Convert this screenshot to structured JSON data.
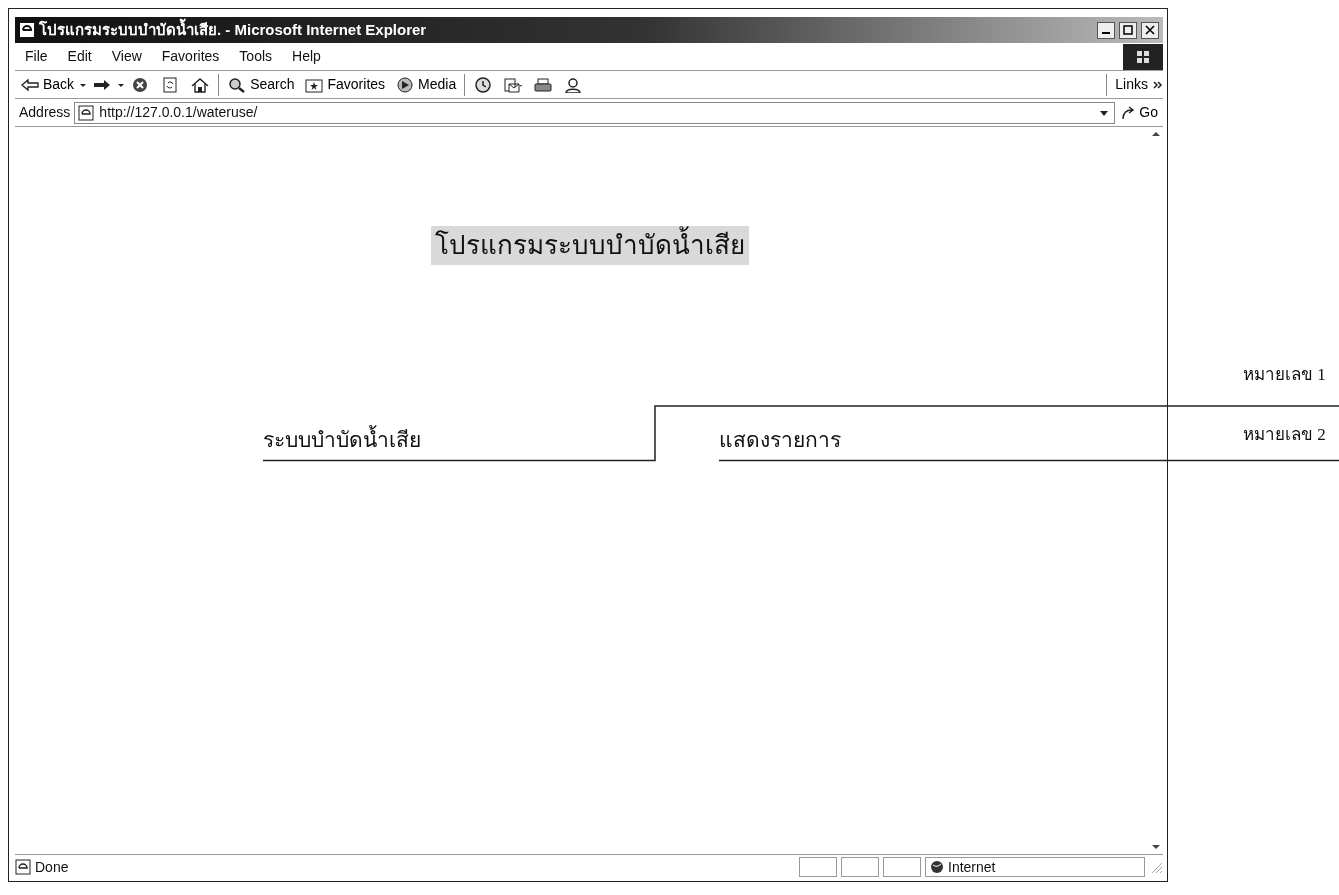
{
  "window": {
    "title": "โปรแกรมระบบบำบัดน้ำเสีย. - Microsoft Internet Explorer"
  },
  "menu": [
    "File",
    "Edit",
    "View",
    "Favorites",
    "Tools",
    "Help"
  ],
  "toolbar": [
    {
      "kind": "back",
      "label": "Back"
    },
    {
      "kind": "forward"
    },
    {
      "kind": "stop"
    },
    {
      "kind": "refresh"
    },
    {
      "kind": "home"
    },
    {
      "kind": "search",
      "label": "Search"
    },
    {
      "kind": "favorites",
      "label": "Favorites"
    },
    {
      "kind": "media",
      "label": "Media"
    },
    {
      "kind": "history"
    },
    {
      "kind": "mail"
    },
    {
      "kind": "print"
    },
    {
      "kind": "messenger"
    }
  ],
  "links_label": "Links",
  "address": {
    "label": "Address",
    "value": "http://127.0.0.1/wateruse/",
    "go": "Go"
  },
  "page": {
    "heading": "โปรแกรมระบบบำบัดน้ำเสีย",
    "links": [
      "ระบบบำบัดน้ำเสีย",
      "แสดงรายการ"
    ]
  },
  "status_bar": {
    "text": "Done",
    "zone": "Internet"
  },
  "callouts": [
    "หมายเลข 1",
    "หมายเลข 2"
  ]
}
